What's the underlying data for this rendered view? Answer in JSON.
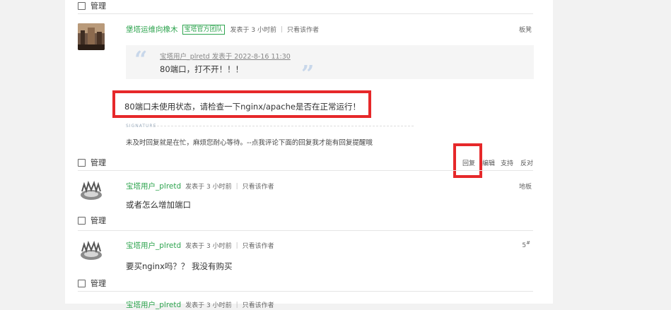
{
  "manage_label": "管理",
  "post1": {
    "username": "堡塔运维向橡木",
    "badge": "宝塔官方团队",
    "posted": "发表于 3 小时前",
    "only_author": "只看该作者",
    "floor": "板凳",
    "quote_meta": "宝塔用户_plretd 发表于 2022-8-16 11:30",
    "quote_text": "80端口，打不开！！！",
    "reply_text": "80端口未使用状态，请检查一下nginx/apache是否在正常运行！",
    "signature_label": "SIGNATURE",
    "signature_text": "未及时回复就是在忙，麻烦您耐心等待。--点我评论下面的回复我才能有回复提醒哦",
    "actions": {
      "reply": "回复",
      "edit": "编辑",
      "support": "支持",
      "oppose": "反对"
    }
  },
  "post2": {
    "username": "宝塔用户_plretd",
    "posted": "发表于 3 小时前",
    "only_author": "只看该作者",
    "floor": "地板",
    "text": "或者怎么增加端口"
  },
  "post3": {
    "username": "宝塔用户_plretd",
    "posted": "发表于 3 小时前",
    "only_author": "只看该作者",
    "floor": "5",
    "floor_sup": "#",
    "text": "要买nginx吗？？ 我没有购买"
  },
  "post4": {
    "username": "宝塔用户_plretd",
    "posted": "发表于 3 小时前",
    "only_author": "只看该作者"
  },
  "colors": {
    "username_green": "#2ea44f",
    "highlight_red": "#e6282a",
    "quote_mark_blue": "#c8d7ea"
  }
}
